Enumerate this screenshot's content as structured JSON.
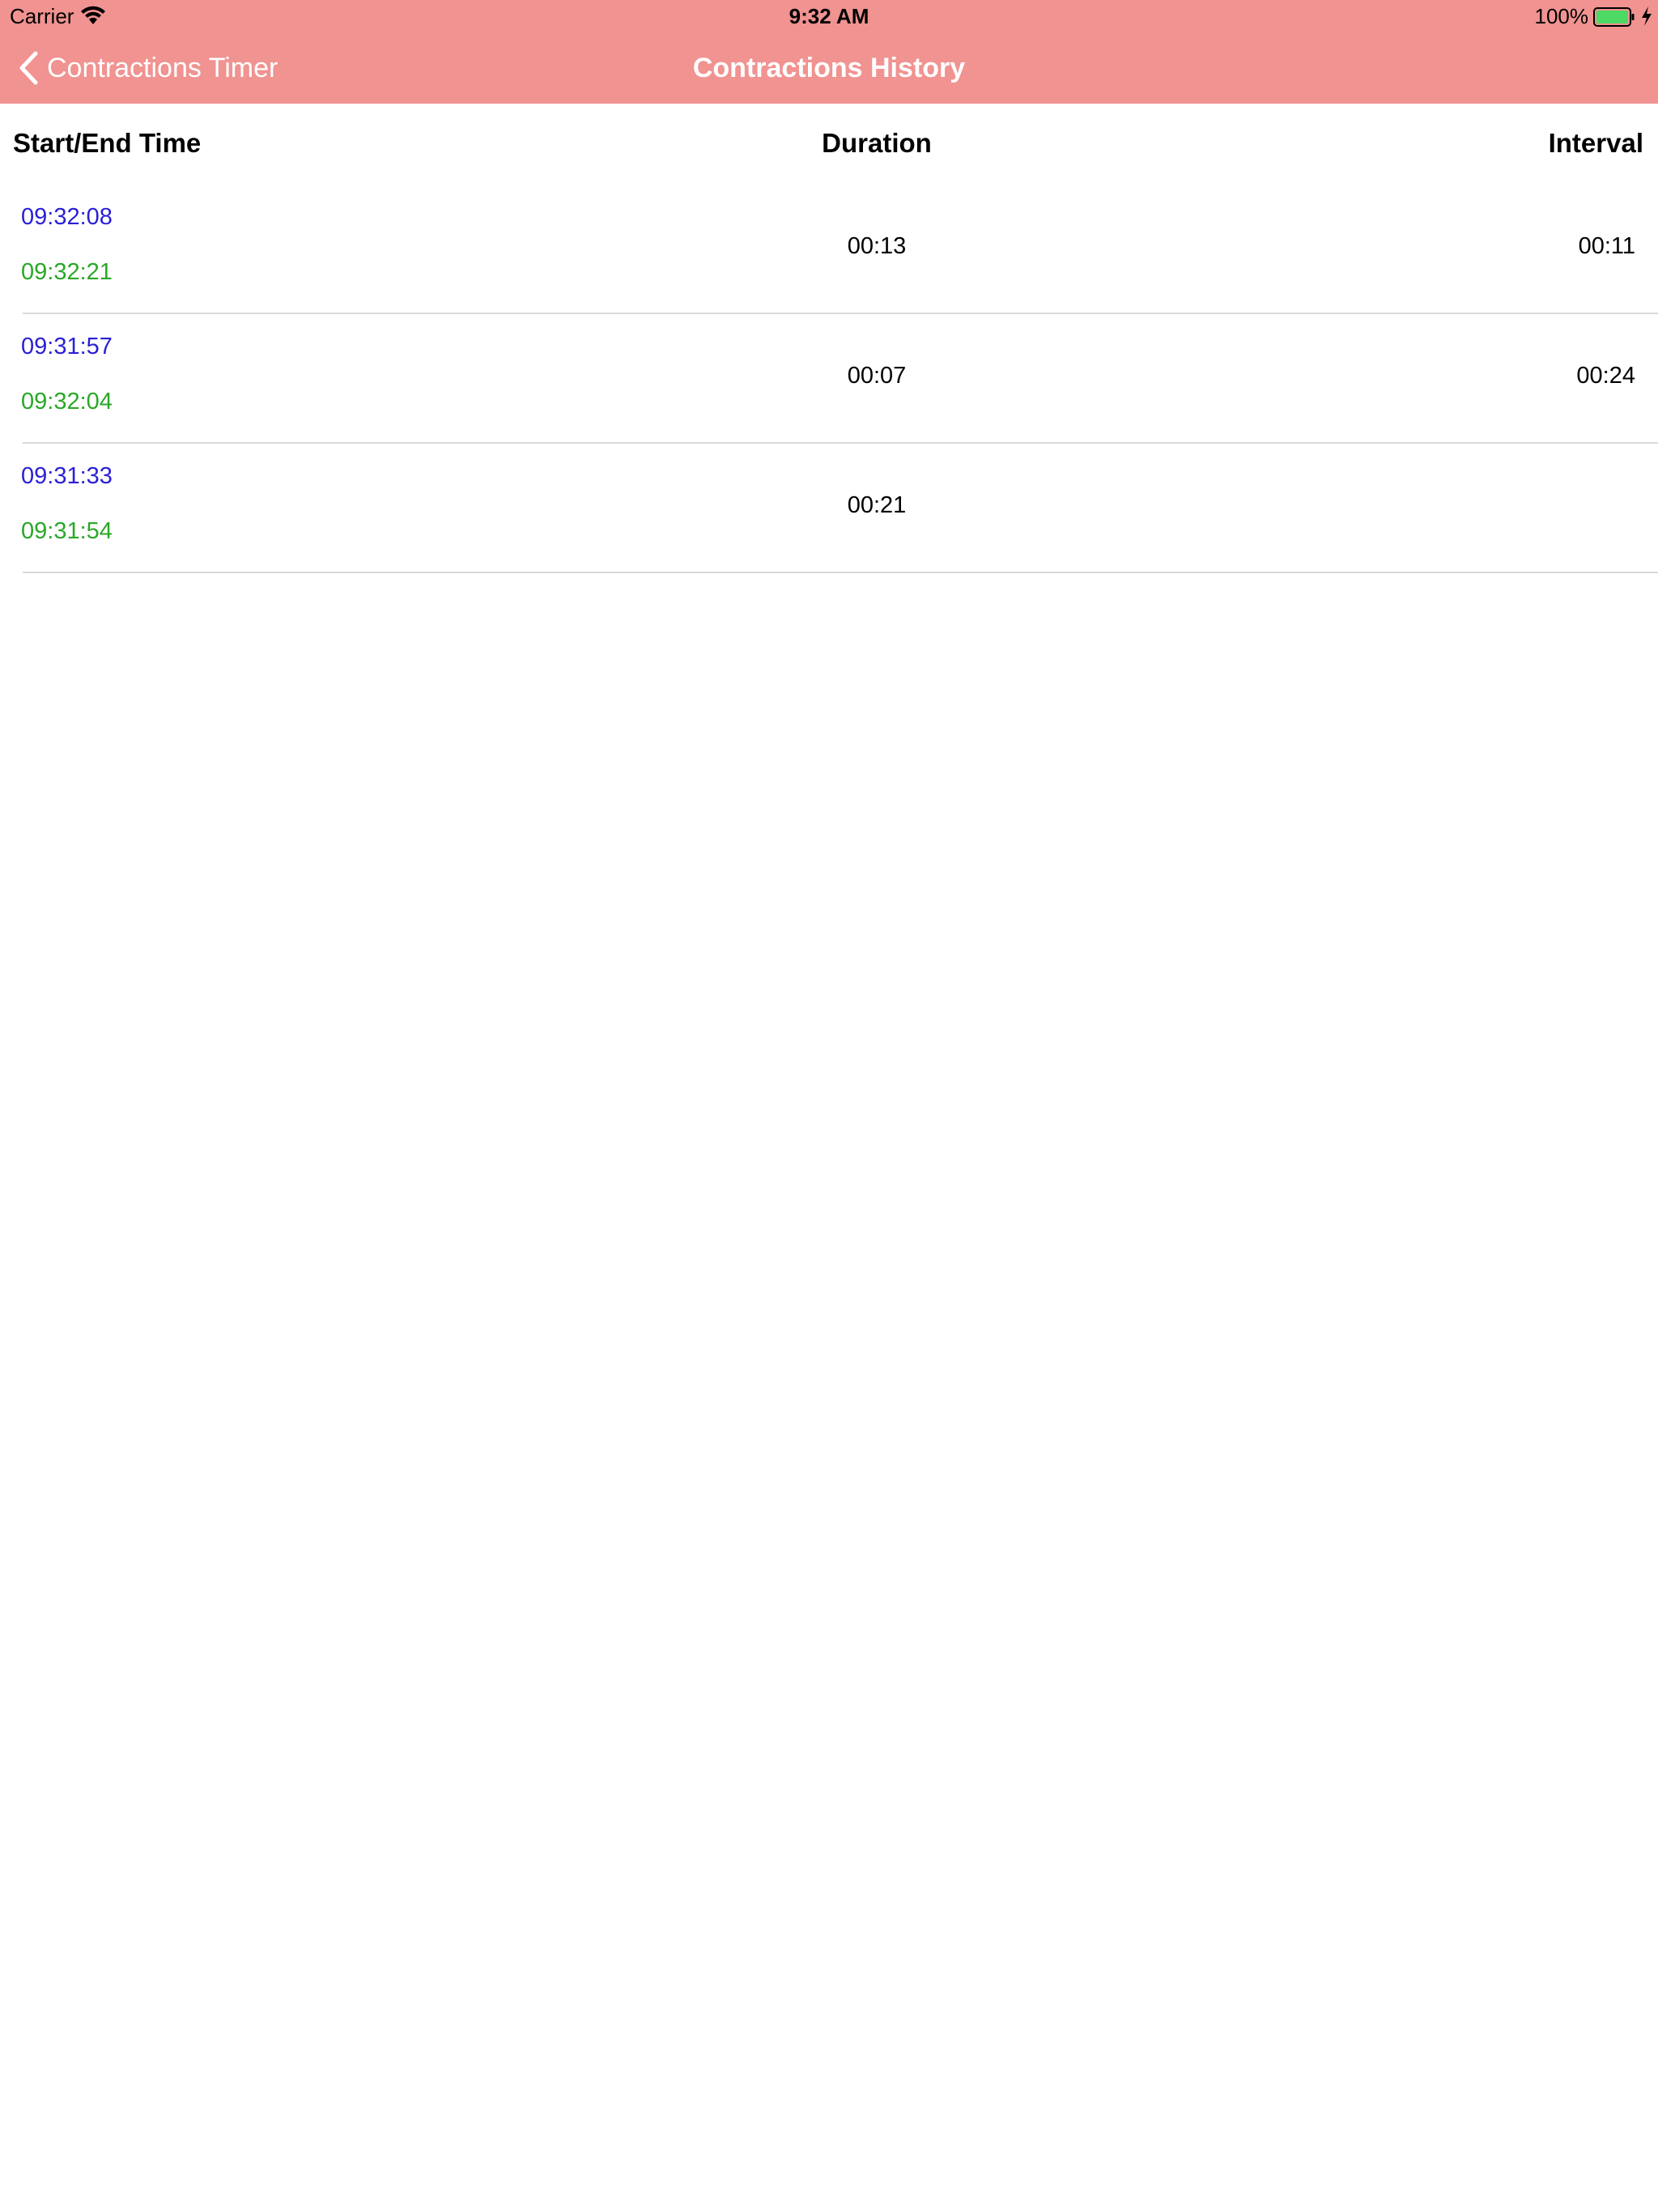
{
  "colors": {
    "nav_background": "#f09391",
    "start_time": "#2a1fd6",
    "end_time": "#2aa828",
    "battery_fill": "#4cd964"
  },
  "status_bar": {
    "carrier": "Carrier",
    "time": "9:32 AM",
    "battery": "100%",
    "icons": [
      "wifi-icon",
      "battery-icon",
      "charging-bolt-icon"
    ]
  },
  "nav": {
    "back_label": "Contractions Timer",
    "back_icon": "chevron-left-icon",
    "title": "Contractions History"
  },
  "table": {
    "headers": {
      "start_end": "Start/End Time",
      "duration": "Duration",
      "interval": "Interval"
    },
    "rows": [
      {
        "start": "09:32:08",
        "end": "09:32:21",
        "duration": "00:13",
        "interval": "00:11"
      },
      {
        "start": "09:31:57",
        "end": "09:32:04",
        "duration": "00:07",
        "interval": "00:24"
      },
      {
        "start": "09:31:33",
        "end": "09:31:54",
        "duration": "00:21",
        "interval": ""
      }
    ]
  }
}
